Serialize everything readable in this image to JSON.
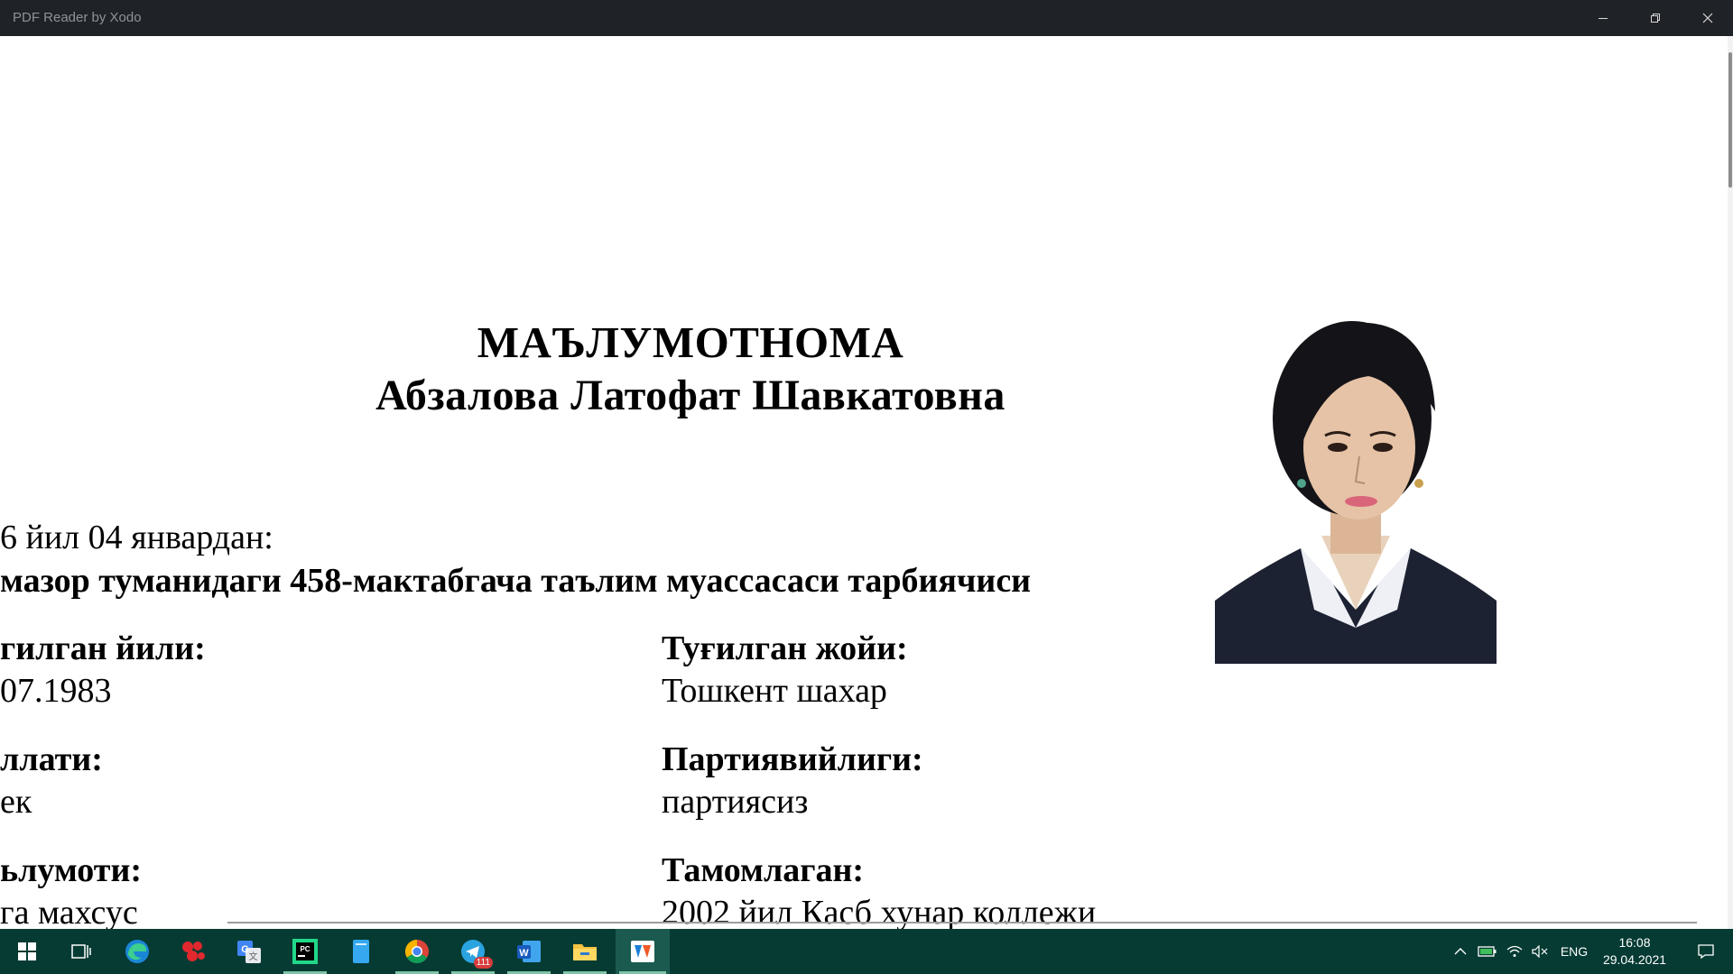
{
  "window": {
    "title": "PDF Reader by Xodo",
    "controls": [
      "minimize-icon",
      "restore-icon",
      "close-icon"
    ]
  },
  "document": {
    "heading": "МАЪЛУМОТНОМА",
    "person_name": "Абзалова Латофат Шавкатовна",
    "since_line": "6 йил 04 январдан:",
    "position_line": "мазор туманидаги 458-мактабгача таълим муассасаси  тарбиячиси",
    "fields": [
      {
        "label": "гилган йили:",
        "value": "07.1983"
      },
      {
        "label": "Туғилган жойи:",
        "value": "Тошкент шахар"
      },
      {
        "label": "ллати:",
        "value": "ек"
      },
      {
        "label": "Партиявийлиги:",
        "value": "партиясиз"
      },
      {
        "label": "ьлумоти:",
        "value": "га махсус"
      },
      {
        "label": "Тамомлаган:",
        "value": "2002 йил Касб хунар коллежи"
      }
    ],
    "photo_alt": "portrait-photo"
  },
  "taskbar": {
    "apps": [
      {
        "name": "start-icon"
      },
      {
        "name": "task-view-icon"
      },
      {
        "name": "edge-icon"
      },
      {
        "name": "molecule-app-icon"
      },
      {
        "name": "translate-icon"
      },
      {
        "name": "pycharm-icon"
      },
      {
        "name": "notepad-icon"
      },
      {
        "name": "chrome-icon"
      },
      {
        "name": "telegram-icon",
        "badge": "111"
      },
      {
        "name": "word-icon"
      },
      {
        "name": "file-explorer-icon"
      },
      {
        "name": "pdf-reader-icon"
      }
    ],
    "tray": {
      "language": "ENG",
      "time": "16:08",
      "date": "29.04.2021"
    }
  },
  "colors": {
    "titlebar": "#1f2227",
    "taskbar": "#063b33",
    "page": "#ffffff"
  }
}
